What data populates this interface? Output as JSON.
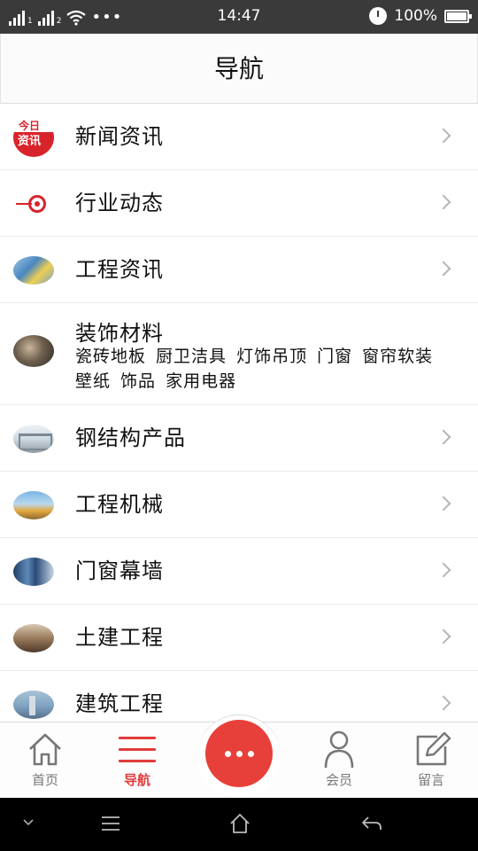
{
  "status_bar": {
    "time": "14:47",
    "battery": "100%",
    "sim1": "1",
    "sim2": "2",
    "more": "•••",
    "icons": [
      "signal-icon",
      "signal-icon",
      "wifi-icon",
      "alarm-icon",
      "battery-icon"
    ]
  },
  "header": {
    "title": "导航"
  },
  "nav_items": [
    {
      "label": "新闻资讯",
      "icon": "jinri-zixun-logo",
      "badge_top": "今日",
      "badge_bottom": "资讯"
    },
    {
      "label": "行业动态",
      "icon": "target-icon"
    },
    {
      "label": "工程资讯",
      "icon": "engineering-thumb"
    },
    {
      "label": "装饰材料",
      "icon": "decoration-thumb",
      "sub": "瓷砖地板 厨卫洁具 灯饰吊顶 门窗 窗帘软装 壁纸 饰品 家用电器"
    },
    {
      "label": "钢结构产品",
      "icon": "steel-structure-thumb"
    },
    {
      "label": "工程机械",
      "icon": "machinery-thumb"
    },
    {
      "label": "门窗幕墙",
      "icon": "curtain-wall-thumb"
    },
    {
      "label": "土建工程",
      "icon": "civil-works-thumb"
    },
    {
      "label": "建筑工程",
      "icon": "building-thumb"
    }
  ],
  "tab_bar": {
    "home": "首页",
    "nav": "导航",
    "member": "会员",
    "message": "留言",
    "active": "nav",
    "accent_color": "#e03c3c",
    "fab_color": "#e7403a"
  }
}
